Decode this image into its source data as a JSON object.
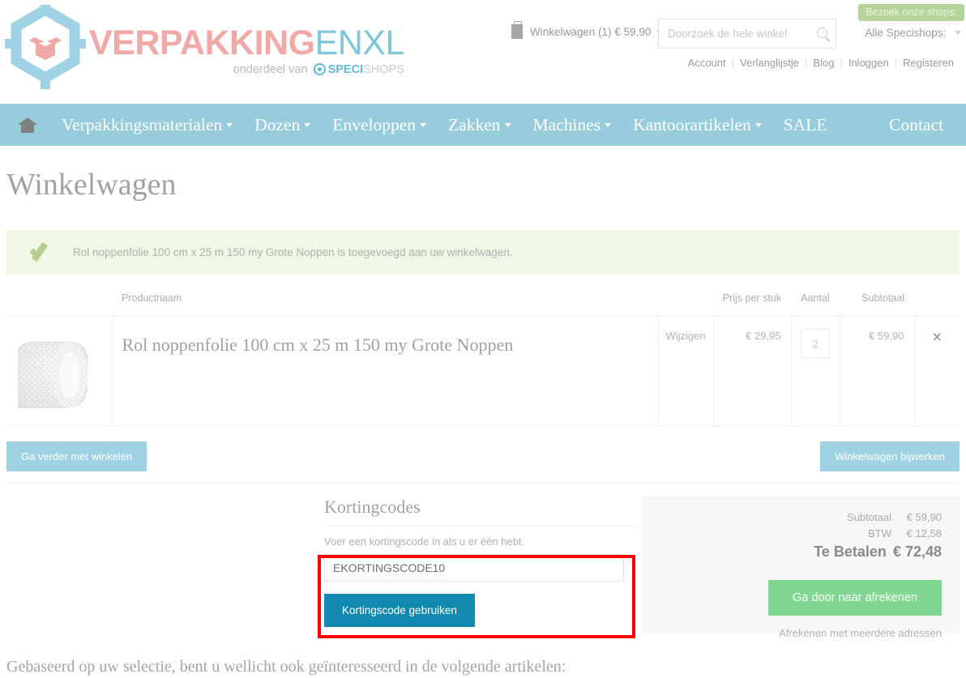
{
  "header": {
    "logo": {
      "part1": "VERPAKKING",
      "part2": "ENXL",
      "tagline_prefix": "onderdeel van",
      "tagline_brand": "SPECI",
      "tagline_brand2": "SHOPS"
    },
    "cart_label": "Winkelwagen (1) € 59,90",
    "search_placeholder": "Doorzoek de hele winkel",
    "shops_tooltip": "Bezoek onze shops:",
    "shops_selector": "Alle Specishops:",
    "util_links": [
      "Account",
      "Verlanglijstje",
      "Blog",
      "Inloggen",
      "Registeren"
    ]
  },
  "nav": {
    "home_icon": "home-icon",
    "items": [
      {
        "label": "Verpakkingsmaterialen",
        "dropdown": true
      },
      {
        "label": "Dozen",
        "dropdown": true
      },
      {
        "label": "Enveloppen",
        "dropdown": true
      },
      {
        "label": "Zakken",
        "dropdown": true
      },
      {
        "label": "Machines",
        "dropdown": true
      },
      {
        "label": "Kantoorartikelen",
        "dropdown": true
      },
      {
        "label": "SALE",
        "dropdown": false
      }
    ],
    "contact": "Contact"
  },
  "page": {
    "title": "Winkelwagen",
    "alert_message": "Rol noppenfolie 100 cm x 25 m 150 my Grote Noppen is toegevoegd aan uw winkelwagen."
  },
  "table": {
    "headers": {
      "name": "Productnaam",
      "price": "Prijs per stuk",
      "qty": "Aantal",
      "subtotal": "Subtotaal"
    },
    "rows": [
      {
        "image_alt": "bubble-wrap-roll",
        "name": "Rol noppenfolie 100 cm x 25 m 150 my Grote Noppen",
        "edit_label": "Wijzigen",
        "price": "€ 29,95",
        "qty": "2",
        "subtotal": "€ 59,90",
        "delete_icon": "×"
      }
    ]
  },
  "actions": {
    "continue_shopping": "Ga verder met winkelen",
    "update_cart": "Winkelwagen bijwerken"
  },
  "coupon": {
    "heading": "Kortingcodes",
    "note": "Voer een kortingscode in als u er één hebt.",
    "input_value": "EKORTINGSCODE10",
    "apply_button": "Kortingscode gebruiken"
  },
  "totals": {
    "subtotal_label": "Subtotaal",
    "subtotal_value": "€ 59,90",
    "vat_label": "BTW",
    "vat_value": "€ 12,58",
    "grand_label": "Te Betalen",
    "grand_value": "€ 72,48",
    "checkout_button": "Ga door naar afrekenen",
    "multi_address": "Afrekenen met meerdere adressen"
  },
  "footer": {
    "related_text": "Gebaseerd op uw selectie, bent u wellicht ook geïnteresseerd in de volgende artikelen:"
  },
  "colors": {
    "nav_bg": "#97ccdd",
    "accent_pink": "#f0a9a6",
    "accent_blue": "#7fc5dc",
    "button_light": "#9ed2e2",
    "button_teal": "#128ab0",
    "button_green": "#7fd790",
    "alert_bg": "#f0f7e4",
    "annotation_red": "#ff0000"
  }
}
